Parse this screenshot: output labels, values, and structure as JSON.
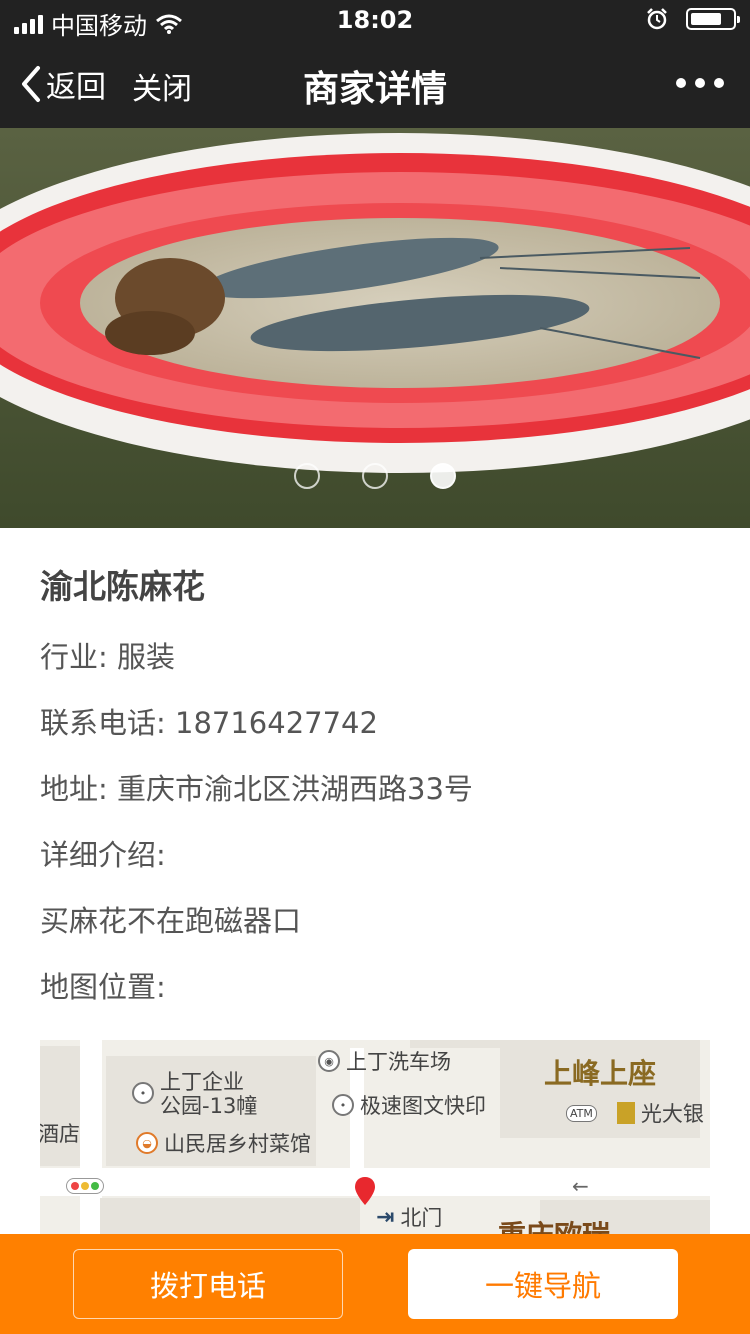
{
  "status_bar": {
    "carrier": "中国移动",
    "time": "18:02"
  },
  "nav": {
    "back_label": "返回",
    "close_label": "关闭",
    "title": "商家详情"
  },
  "banner": {
    "slide_count": 3,
    "active_index": 2
  },
  "shop": {
    "name": "渝北陈麻花",
    "industry": "行业: 服装",
    "phone": "联系电话: 18716427742",
    "address": "地址: 重庆市渝北区洪湖西路33号",
    "intro_label": "详细介绍:",
    "intro_text": "买麻花不在跑磁器口",
    "map_label": "地图位置:"
  },
  "map": {
    "poi_carwash": "上丁洗车场",
    "poi_park_line1": "上丁企业",
    "poi_park_line2": "公园-13幢",
    "poi_print": "极速图文快印",
    "poi_peak": "上峰上座",
    "poi_bank": "光大银",
    "poi_hotel": "酒店",
    "poi_restaurant": "山民居乡村菜馆",
    "poi_north_gate": "北门",
    "poi_bottom": "重庆欧瑞",
    "atm": "ATM"
  },
  "actions": {
    "call_label": "拨打电话",
    "navigate_label": "一键导航"
  }
}
